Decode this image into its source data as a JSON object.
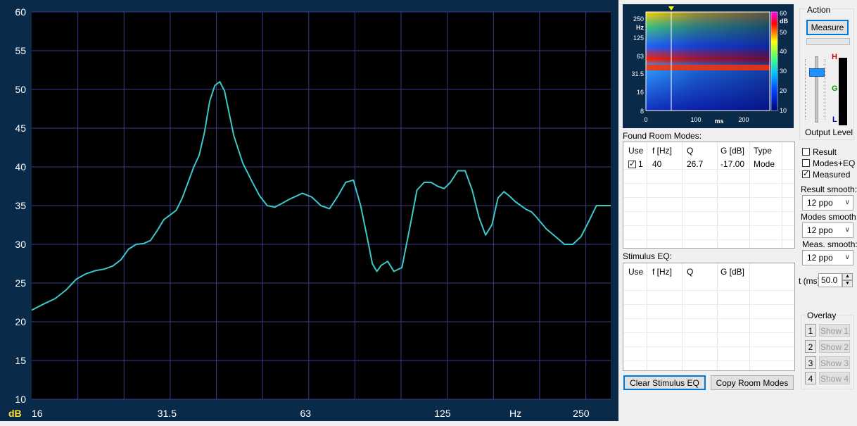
{
  "main_plot": {
    "y_tick_labels": [
      "60",
      "55",
      "50",
      "45",
      "40",
      "35",
      "30",
      "25",
      "20",
      "15",
      "10"
    ],
    "x_tick_labels": [
      "16",
      "31.5",
      "63",
      "125",
      "Hz",
      "250"
    ],
    "y_unit": "dB",
    "line_color": "#3cc8c8",
    "background_color": "#000000",
    "grid_color": "#3a3a8a"
  },
  "chart_data": {
    "type": "line",
    "x_scale": "log",
    "xlabel": "Hz",
    "ylabel": "dB",
    "ylim": [
      10,
      60
    ],
    "xlim": [
      16,
      290
    ],
    "series": [
      {
        "x": [
          16,
          17,
          18,
          19,
          20,
          21,
          22,
          23,
          24,
          25,
          26,
          27,
          28,
          29,
          30,
          31,
          32,
          33,
          34,
          35,
          36,
          37,
          38,
          39,
          40,
          41,
          42,
          44,
          46,
          48,
          50,
          52,
          54,
          56,
          58,
          60,
          62,
          65,
          68,
          71,
          74,
          77,
          80,
          83,
          86,
          88,
          90,
          92,
          95,
          98,
          102,
          106,
          110,
          114,
          118,
          122,
          126,
          130,
          135,
          140,
          145,
          150,
          155,
          160,
          165,
          170,
          175,
          180,
          185,
          190,
          195,
          200,
          210,
          220,
          230,
          240,
          250,
          260,
          270,
          280,
          290
        ],
        "y": [
          21.5,
          22.3,
          23.0,
          24.1,
          25.5,
          26.2,
          26.6,
          26.8,
          27.2,
          28.0,
          29.4,
          30.0,
          30.1,
          30.5,
          31.8,
          33.2,
          33.8,
          34.4,
          36.0,
          38.0,
          40.0,
          41.5,
          44.5,
          48.5,
          50.5,
          51.0,
          49.8,
          44.0,
          40.5,
          38.3,
          36.3,
          35.0,
          34.8,
          35.3,
          35.8,
          36.2,
          36.6,
          36.1,
          35.0,
          34.6,
          36.2,
          38.0,
          38.3,
          35.0,
          30.5,
          27.5,
          26.5,
          27.3,
          27.8,
          26.5,
          27.0,
          32.0,
          37.0,
          38.0,
          38.0,
          37.5,
          37.2,
          38.0,
          39.5,
          39.5,
          37.0,
          33.5,
          31.2,
          32.5,
          36.0,
          36.8,
          36.2,
          35.5,
          35.0,
          34.5,
          34.2,
          33.5,
          32.0,
          31.0,
          30.0,
          30.0,
          31.0,
          33.0,
          35.0,
          35.0,
          35.0
        ]
      }
    ]
  },
  "spectrogram": {
    "y_unit_label": "Hz",
    "y_tick_labels": [
      "250",
      "125",
      "63",
      "31.5",
      "16",
      "8"
    ],
    "x_tick_labels": [
      "0",
      "100",
      "ms",
      "200"
    ],
    "colorbar_labels": [
      "60",
      "50",
      "40",
      "30",
      "20",
      "10"
    ],
    "colorbar_unit": "dB"
  },
  "action": {
    "group_label": "Action",
    "measure_label": "Measure",
    "output_level_label": "Output Level",
    "meter_h": "H",
    "meter_g": "G",
    "meter_l": "L"
  },
  "room_modes": {
    "title": "Found Room Modes:",
    "columns": [
      "Use",
      "f [Hz]",
      "Q",
      "G [dB]",
      "Type"
    ],
    "rows": [
      {
        "use_num": "1",
        "checked": true,
        "f": "40",
        "q": "26.7",
        "g": "-17.00",
        "type": "Mode"
      }
    ]
  },
  "stimulus_eq": {
    "title": "Stimulus EQ:",
    "columns": [
      "Use",
      "f [Hz]",
      "Q",
      "G [dB]"
    ]
  },
  "buttons": {
    "clear_stimulus": "Clear Stimulus EQ",
    "copy_room_modes": "Copy Room Modes"
  },
  "options": {
    "result_label": "Result",
    "result_checked": false,
    "modes_eq_label": "Modes+EQ",
    "modes_eq_checked": false,
    "measured_label": "Measured",
    "measured_checked": true,
    "result_smooth_label": "Result smooth:",
    "result_smooth_value": "12 ppo",
    "modes_smooth_label": "Modes smooth:",
    "modes_smooth_value": "12 ppo",
    "meas_smooth_label": "Meas. smooth:",
    "meas_smooth_value": "12 ppo",
    "t_label": "t (ms)",
    "t_value": "50.0"
  },
  "overlay": {
    "group_label": "Overlay",
    "items": [
      {
        "num": "1",
        "label": "Show 1"
      },
      {
        "num": "2",
        "label": "Show 2"
      },
      {
        "num": "3",
        "label": "Show 3"
      },
      {
        "num": "4",
        "label": "Show 4"
      }
    ]
  }
}
